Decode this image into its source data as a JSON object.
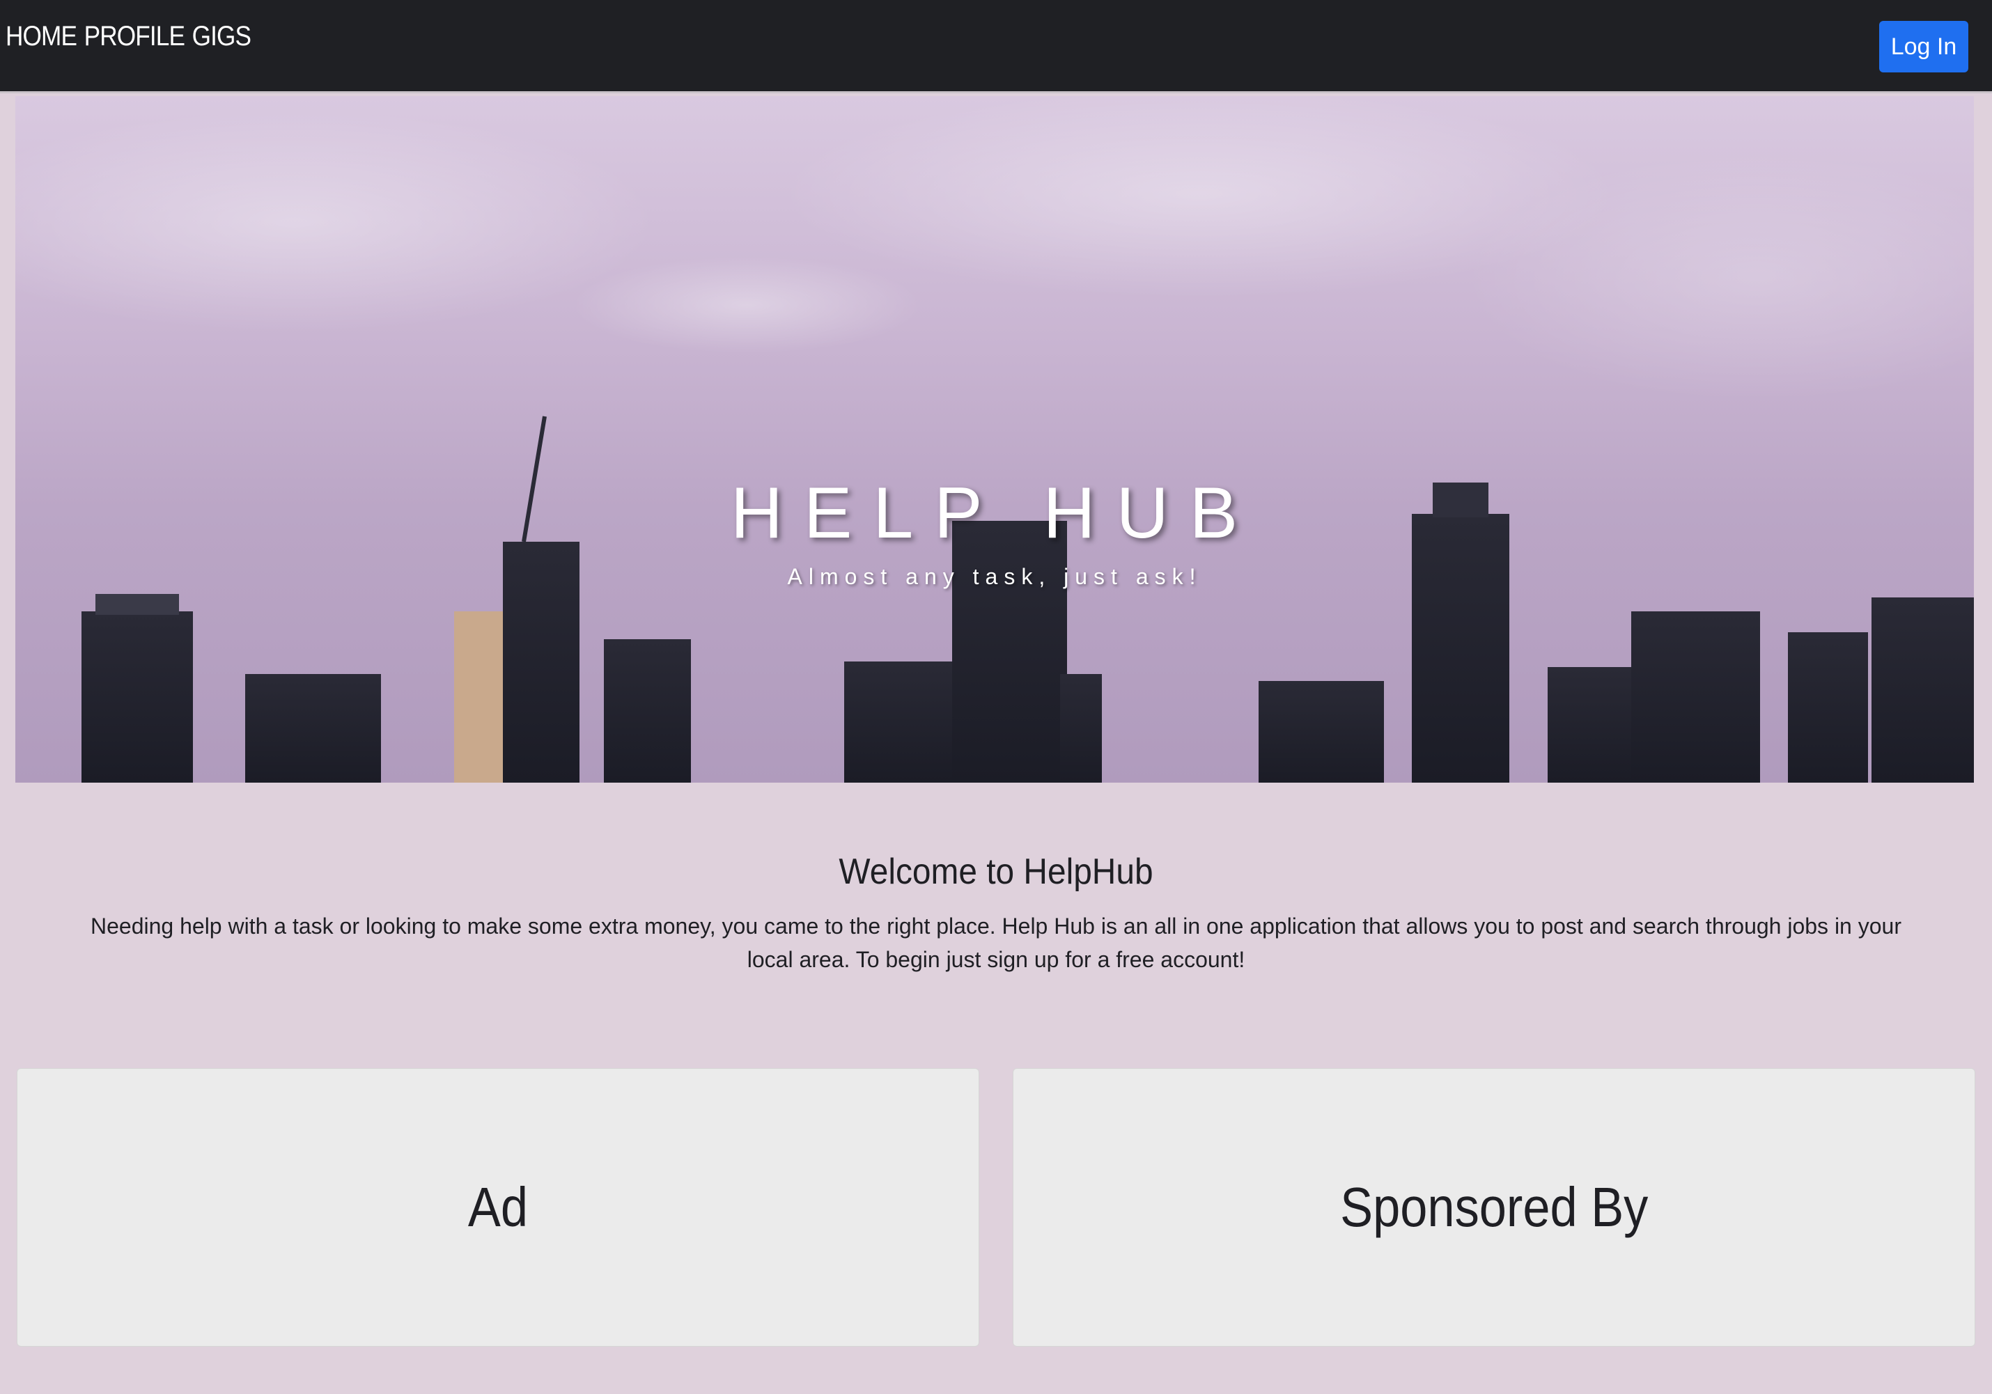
{
  "nav": {
    "links": [
      "HOME",
      "PROFILE",
      "GIGS"
    ],
    "login_label": "Log In"
  },
  "hero": {
    "title": "HELP HUB",
    "subtitle": "Almost any task, just ask!"
  },
  "welcome": {
    "title": "Welcome to HelpHub",
    "text": "Needing help with a task or looking to make some extra money, you came to the right place. Help Hub is an all in one application that allows you to post and search through jobs in your local area. To begin just sign up for a free account!"
  },
  "cards": {
    "ad": "Ad",
    "sponsor": "Sponsored By"
  },
  "colors": {
    "navbar": "#1f2024",
    "login_button": "#1f6ff0",
    "page_background": "#dfd1dc",
    "card_background": "#ebebeb"
  }
}
